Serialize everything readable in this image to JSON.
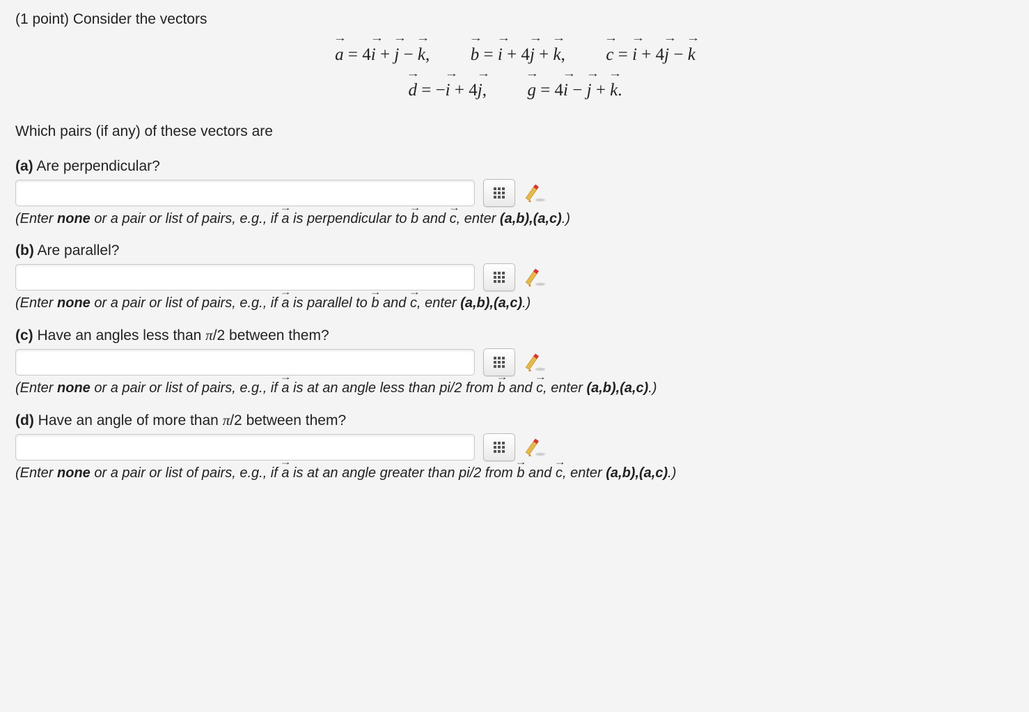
{
  "points": "(1 point)",
  "intro": "Consider the vectors",
  "equation_line1_html": "<span class='vec'><i>a</i></span> = 4<span class='vec'><i>i</i></span> + <span class='vec'><i>j</i></span> − <span class='vec'><i>k</i></span>, <span class='gap'></span> <span class='vec'><i>b</i></span> = <span class='vec'><i>i</i></span> + 4<span class='vec'><i>j</i></span> + <span class='vec'><i>k</i></span>, <span class='gap'></span> <span class='vec'><i>c</i></span> = <span class='vec'><i>i</i></span> + 4<span class='vec'><i>j</i></span> − <span class='vec'><i>k</i></span>",
  "equation_line2_html": "<span class='vec'><i>d</i></span> = −<span class='vec'><i>i</i></span> + 4<span class='vec'><i>j</i></span>, <span class='gap'></span> <span class='vec'><i>g</i></span> = 4<span class='vec'><i>i</i></span> − <span class='vec'><i>j</i></span> + <span class='vec'><i>k</i></span>.",
  "which_text": "Which pairs (if any) of these vectors are",
  "parts": {
    "a": {
      "label": "(a)",
      "question": "Are perpendicular?",
      "hint_html": "(Enter <b>none</b> or a pair or list of pairs, e.g., if <span class='vec-small'>a</span> is perpendicular to <span class='vec-small'>b</span> and <span class='vec-small'>c</span>, enter <span class='exbold'>(a,b),(a,c)</span>.)"
    },
    "b": {
      "label": "(b)",
      "question": "Are parallel?",
      "hint_html": "(Enter <b>none</b> or a pair or list of pairs, e.g., if <span class='vec-small'>a</span> is parallel to <span class='vec-small'>b</span> and <span class='vec-small'>c</span>, enter <span class='exbold'>(a,b),(a,c)</span>.)"
    },
    "c": {
      "label": "(c)",
      "question_html": "Have an angles less than <span class='math-inline'>π</span>/2 between them?",
      "hint_html": "(Enter <b>none</b> or a pair or list of pairs, e.g., if <span class='vec-small'>a</span> is at an angle less than pi/2 from <span class='vec-small'>b</span> and <span class='vec-small'>c</span>, enter <span class='exbold'>(a,b),(a,c)</span>.)"
    },
    "d": {
      "label": "(d)",
      "question_html": "Have an angle of more than <span class='math-inline'>π</span>/2 between them?",
      "hint_html": "(Enter <b>none</b> or a pair or list of pairs, e.g., if <span class='vec-small'>a</span> is at an angle greater than pi/2 from <span class='vec-small'>b</span> and <span class='vec-small'>c</span>, enter <span class='exbold'>(a,b),(a,c)</span>.)"
    }
  }
}
